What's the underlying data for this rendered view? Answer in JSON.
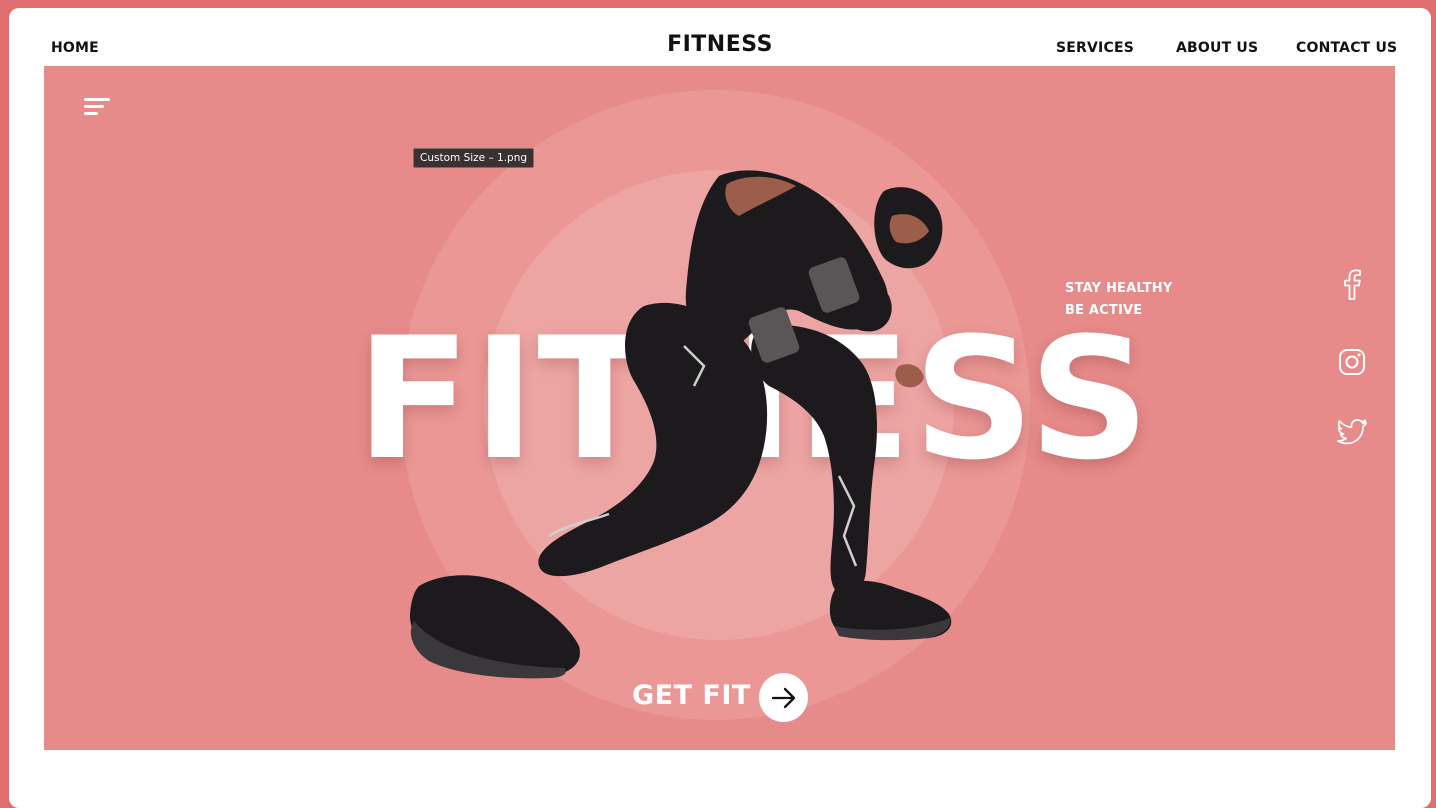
{
  "header": {
    "brand": "FITNESS",
    "nav_left": [
      {
        "label": "HOME"
      }
    ],
    "nav_right": [
      {
        "label": "SERVICES"
      },
      {
        "label": "ABOUT US"
      },
      {
        "label": "CONTACT US"
      }
    ]
  },
  "hero": {
    "background_color": "#e68b8a",
    "title": "FITNESS",
    "tagline": [
      "STAY HEALTHY",
      "BE ACTIVE"
    ],
    "tooltip": "Custom Size – 1.png",
    "cta": {
      "label": "GET FIT",
      "icon": "arrow-right-icon"
    },
    "social": [
      {
        "icon": "facebook-icon"
      },
      {
        "icon": "instagram-icon"
      },
      {
        "icon": "twitter-icon"
      }
    ],
    "menu_icon": "hamburger-menu-icon"
  },
  "colors": {
    "outer_frame": "#e06e6e",
    "hero": "#e68b8a",
    "circle_outer": "#ea9796",
    "circle_inner": "#eda5a4",
    "text_dark": "#111111",
    "text_light": "#ffffff"
  }
}
